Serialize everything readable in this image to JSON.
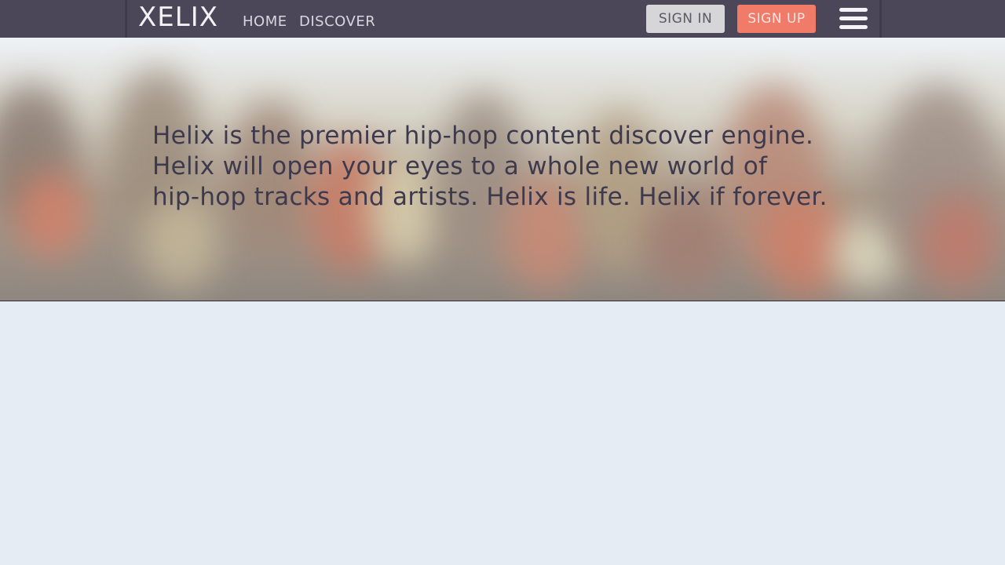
{
  "navbar": {
    "logo": "XELIX",
    "links": [
      "HOME",
      "DISCOVER"
    ],
    "signin_label": "SIGN IN",
    "signup_label": "SIGN UP",
    "menu_icon": "hamburger-menu-icon"
  },
  "hero": {
    "lines": [
      "Helix is the premier hip-hop content discover engine.",
      "Helix will open your eyes to a whole new world of",
      "hip-hop tracks and artists. Helix is life. Helix if forever."
    ]
  },
  "colors": {
    "navbar_bg": "#4b4759",
    "signin_bg": "#d6d6d8",
    "signup_bg": "#f07b69",
    "hero_text": "#3e3a4d",
    "page_bg": "#e5ecf4"
  }
}
